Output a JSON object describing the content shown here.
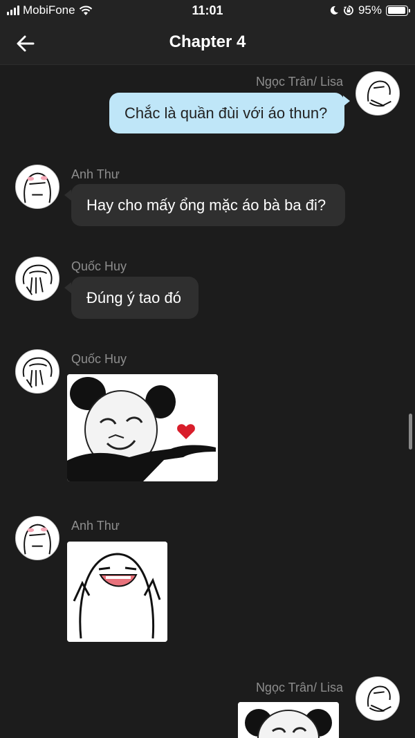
{
  "status_bar": {
    "carrier": "MobiFone",
    "time": "11:01",
    "battery_percent": "95%",
    "battery_level": 0.95,
    "icons": [
      "signal-icon",
      "wifi-icon",
      "moon-icon",
      "rotation-lock-icon",
      "battery-icon"
    ]
  },
  "header": {
    "back_icon": "arrow-left-icon",
    "title": "Chapter 4"
  },
  "messages": [
    {
      "sender": "Ngọc Trân/ Lisa",
      "direction": "outgoing",
      "type": "text",
      "text": "Chắc là quần đùi với áo thun?"
    },
    {
      "sender": "Anh Thư",
      "direction": "incoming",
      "type": "text",
      "text": "Hay cho mấy ổng mặc áo bà ba đi?"
    },
    {
      "sender": "Quốc Huy",
      "direction": "incoming",
      "type": "text",
      "text": "Đúng ý tao đó"
    },
    {
      "sender": "Quốc Huy",
      "direction": "incoming",
      "type": "sticker",
      "sticker": "panda-meme-heart-sticker"
    },
    {
      "sender": "Anh Thư",
      "direction": "incoming",
      "type": "sticker",
      "sticker": "smiling-blob-sticker"
    },
    {
      "sender": "Ngọc Trân/ Lisa",
      "direction": "outgoing",
      "type": "sticker",
      "sticker": "panda-meme-sticker"
    }
  ],
  "colors": {
    "background": "#1c1c1c",
    "bar": "#232323",
    "incoming_bubble": "#2f2f2f",
    "outgoing_bubble": "#bfe6f8",
    "sender_name": "#8e8e8e",
    "heart": "#d81e2b"
  }
}
